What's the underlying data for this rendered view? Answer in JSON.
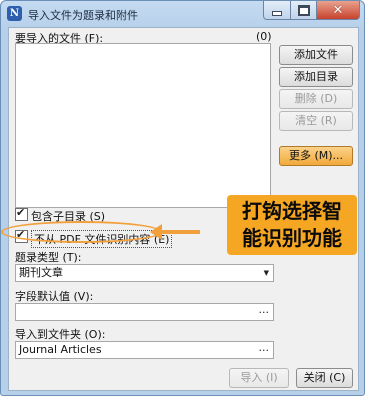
{
  "window": {
    "title": "导入文件为题录和附件",
    "app_icon_letter": "N"
  },
  "files": {
    "label": "要导入的文件 (F):",
    "count": "(0)"
  },
  "buttons": {
    "add_file": "添加文件 (A)...",
    "add_dir": "添加目录 (Y)...",
    "delete": "删除 (D)",
    "clear": "清空 (R)",
    "more": "更多 (M)...",
    "import": "导入 (I)",
    "close": "关闭 (C)"
  },
  "options": {
    "include_subdirs": "包含子目录 (S)",
    "include_subdirs_checked": true,
    "no_pdf_recognize": "不从 PDF 文件识别内容 (E)",
    "no_pdf_recognize_checked": true
  },
  "ref_type": {
    "label": "题录类型 (T):",
    "value": "期刊文章"
  },
  "default_value": {
    "label": "字段默认值 (V):",
    "value": ""
  },
  "target_folder": {
    "label": "导入到文件夹 (O):",
    "value": "Journal Articles"
  },
  "annotation": {
    "line1": "打钩选择智",
    "line2": "能识别功能",
    "color": "#f5a623"
  }
}
